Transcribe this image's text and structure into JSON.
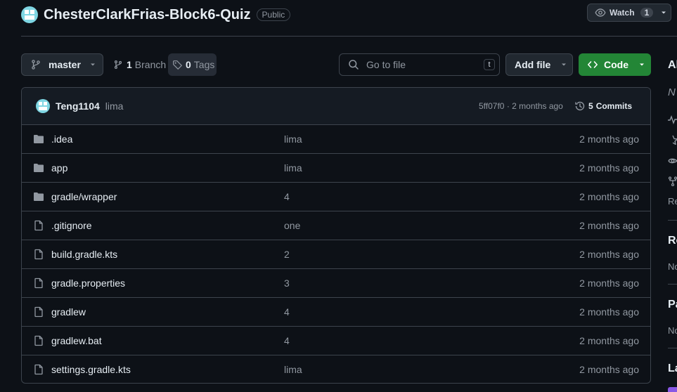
{
  "repo": {
    "name": "ChesterClarkFrias-Block6-Quiz",
    "visibility": "Public",
    "watch_label": "Watch",
    "watch_count": "1"
  },
  "toolbar": {
    "branch": "master",
    "branches_count": "1",
    "branches_label": "Branch",
    "tags_count": "0",
    "tags_label": "Tags",
    "search_placeholder": "Go to file",
    "search_shortcut": "t",
    "add_file_label": "Add file",
    "code_label": "Code"
  },
  "commit": {
    "author": "Teng1104",
    "message": "lima",
    "meta": "5ff07f0 · 2 months ago",
    "commits_count": "5",
    "commits_label": "Commits"
  },
  "files": [
    {
      "type": "folder",
      "name": ".idea",
      "message": "lima",
      "date": "2 months ago"
    },
    {
      "type": "folder",
      "name": "app",
      "message": "lima",
      "date": "2 months ago"
    },
    {
      "type": "folder",
      "name": "gradle/wrapper",
      "message": "4",
      "date": "2 months ago"
    },
    {
      "type": "file",
      "name": ".gitignore",
      "message": "one",
      "date": "2 months ago"
    },
    {
      "type": "file",
      "name": "build.gradle.kts",
      "message": "2",
      "date": "2 months ago"
    },
    {
      "type": "file",
      "name": "gradle.properties",
      "message": "3",
      "date": "2 months ago"
    },
    {
      "type": "file",
      "name": "gradlew",
      "message": "4",
      "date": "2 months ago"
    },
    {
      "type": "file",
      "name": "gradlew.bat",
      "message": "4",
      "date": "2 months ago"
    },
    {
      "type": "file",
      "name": "settings.gradle.kts",
      "message": "lima",
      "date": "2 months ago"
    }
  ],
  "sidebar": {
    "about_heading": "Al",
    "description_fragment": "N",
    "readme_fragment": "Re",
    "releases_heading": "Re",
    "releases_text": "No",
    "packages_heading": "Pa",
    "packages_text": "No",
    "languages_heading": "La"
  },
  "colors": {
    "background": "#0d1117",
    "border": "#3d444d",
    "accent_green": "#238636",
    "muted_text": "#9198a1",
    "icon_gray": "#9198a1"
  }
}
